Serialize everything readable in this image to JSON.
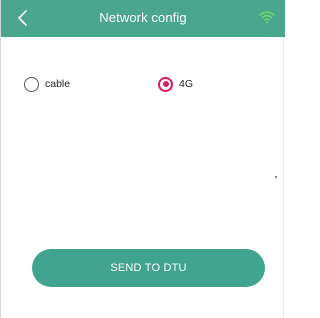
{
  "header": {
    "title": "Network config",
    "back_icon": "chevron-left-icon",
    "wifi_icon": "wifi-icon",
    "background": "#4aa68f"
  },
  "network_mode": {
    "options": [
      {
        "label": "cable",
        "selected": false
      },
      {
        "label": "4G",
        "selected": true
      }
    ],
    "selected_color": "#d81b60"
  },
  "actions": {
    "send_label": "SEND TO DTU",
    "button_color": "#40a48e"
  }
}
